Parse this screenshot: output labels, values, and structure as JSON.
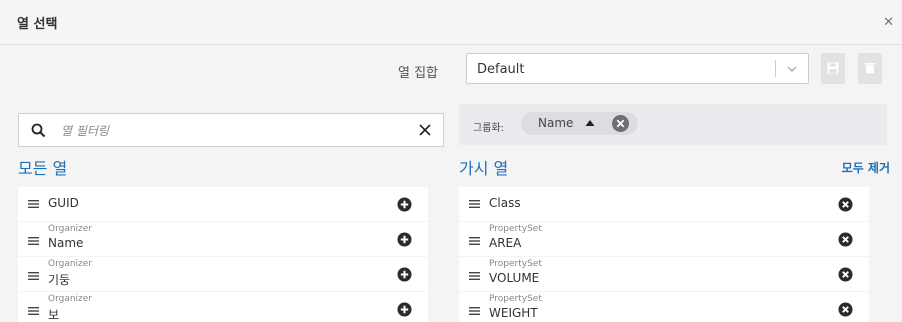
{
  "dialog": {
    "title": "열 선택"
  },
  "toolbar": {
    "column_set_label": "열 집합",
    "column_set_value": "Default"
  },
  "search": {
    "placeholder": "열 필터링"
  },
  "grouping": {
    "label": "그룹화:",
    "chip_label": "Name"
  },
  "all_columns": {
    "title": "모든 열",
    "items": [
      {
        "main": "GUID"
      },
      {
        "category": "Organizer",
        "main": "Name"
      },
      {
        "category": "Organizer",
        "main": "기둥"
      },
      {
        "category": "Organizer",
        "main": "보"
      }
    ]
  },
  "visible_columns": {
    "title": "가시 열",
    "remove_all_label": "모두 제거",
    "items": [
      {
        "main": "Class"
      },
      {
        "category": "PropertySet",
        "main": "AREA"
      },
      {
        "category": "PropertySet",
        "main": "VOLUME"
      },
      {
        "category": "PropertySet",
        "main": "WEIGHT"
      }
    ]
  },
  "colors": {
    "accent": "#1f6fb6",
    "icon_dark": "#2b2b2b",
    "button_disabled": "#e2e2e2"
  },
  "icons": [
    "close-icon",
    "chevron-down-icon",
    "save-icon",
    "delete-icon",
    "search-icon",
    "clear-icon",
    "sort-ascending-icon",
    "remove-chip-icon",
    "drag-handle-icon",
    "add-icon",
    "remove-icon"
  ]
}
